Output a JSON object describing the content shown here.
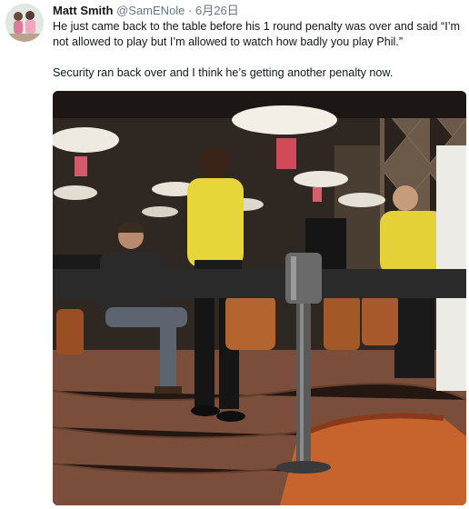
{
  "tweet": {
    "author": {
      "name": "Matt Smith",
      "handle": "@SamENole",
      "avatar_icon": "profile-avatar"
    },
    "separator": "·",
    "date": "6月26日",
    "text": [
      "He just came back to the table before his 1 round penalty was over and said “I’m not allowed to play but I’m allowed to watch how badly you play Phil.”",
      "Security ran back over and I think he’s getting another penalty now."
    ],
    "photo": {
      "alt": "casino tournament room with security guards",
      "colors": {
        "wall": "#3a322b",
        "carpet": "#7a4e3a",
        "lamp": "#f3efe6",
        "shirt_yellow": "#e6d63a",
        "chair_orange": "#c7642e"
      }
    }
  }
}
